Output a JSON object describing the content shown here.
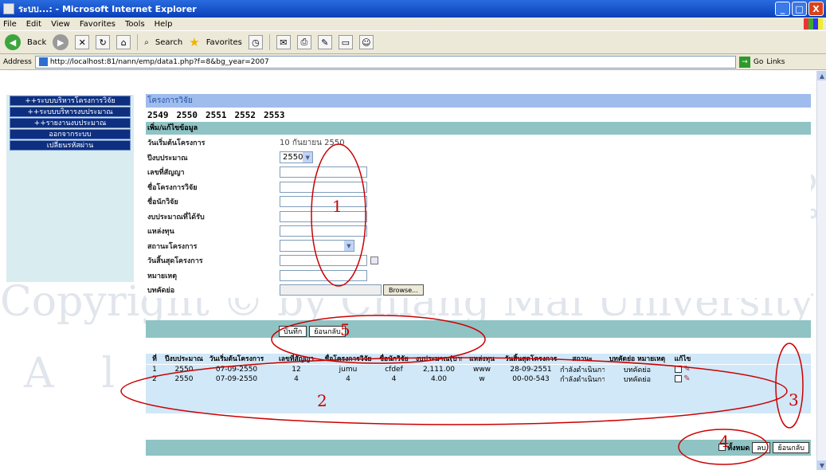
{
  "window": {
    "title": "ระบบ...: - Microsoft Internet Explorer",
    "controls": [
      "_",
      "□",
      "X"
    ]
  },
  "menu": [
    "File",
    "Edit",
    "View",
    "Favorites",
    "Tools",
    "Help"
  ],
  "toolbar": {
    "back": "Back",
    "search": "Search",
    "favorites": "Favorites"
  },
  "address": {
    "label": "Address",
    "url": "http://localhost:81/nann/emp/data1.php?f=8&bg_year=2007",
    "go": "Go",
    "links": "Links"
  },
  "sidebar": {
    "items": [
      "++ระบบบริหารโครงการวิจัย",
      "++ระบบบริหารงบประมาณ",
      "++รายงานงบประมาณ",
      "ออกจากระบบ",
      "เปลี่ยนรหัสผ่าน"
    ]
  },
  "main": {
    "header": "โครงการวิจัย",
    "years": [
      "2549",
      "2550",
      "2551",
      "2552",
      "2553"
    ],
    "form_title": "เพิ่ม/แก้ไขข้อมูล",
    "form": {
      "start_date_label": "วันเริ่มต้นโครงการ",
      "start_date_value": "10 กันยายน 2550",
      "budget_year_label": "ปีงบประมาณ",
      "budget_year_value": "2550",
      "contract_no_label": "เลขที่สัญญา",
      "project_name_label": "ชื่อโครงการวิจัย",
      "researcher_label": "ชื่อนักวิจัย",
      "budget_label": "งบประมาณที่ได้รับ",
      "funding_label": "แหล่งทุน",
      "status_label": "สถานะโครงการ",
      "end_date_label": "วันสิ้นสุดโครงการ",
      "note_label": "หมายเหตุ",
      "abstract_label": "บทคัดย่อ",
      "browse": "Browse..."
    },
    "actions": {
      "save": "บันทึก",
      "back": "ย้อนกลับ"
    },
    "table": {
      "headers": [
        "ที่",
        "ปีงบประมาณ",
        "วันเริ่มต้นโครงการ",
        "เลขที่สัญญา",
        "ชื่อโครงการวิจัย",
        "ชื่อนักวิจัย",
        "งบประมาณ(บาท)",
        "แหล่งทุน",
        "วันสิ้นสุดโครงการ",
        "สถานะ",
        "บทคัดย่อ หมายเหตุ",
        "แก้ไข"
      ],
      "rows": [
        [
          "1",
          "2550",
          "07-09-2550",
          "12",
          "jumu",
          "cfdef",
          "2,111.00",
          "www",
          "28-09-2551",
          "กำลังดำเนินการ",
          "บทคัดย่อ"
        ],
        [
          "2",
          "2550",
          "07-09-2550",
          "4",
          "4",
          "4",
          "4.00",
          "w",
          "00-00-543",
          "กำลังดำเนินการ",
          "บทคัดย่อ"
        ]
      ]
    },
    "bottom": {
      "select_all": "ทั้งหมด",
      "delete": "ลบ",
      "back": "ย้อนกลับ"
    }
  },
  "watermark": {
    "line1": "ลิขสิทธิ์มหาวิทยาลัยเชียงใหม่",
    "line2": "Copyright © by Chiang Mai University",
    "line3": "All rights reserved"
  },
  "annotations": [
    "1",
    "2",
    "3",
    "4",
    "5"
  ]
}
